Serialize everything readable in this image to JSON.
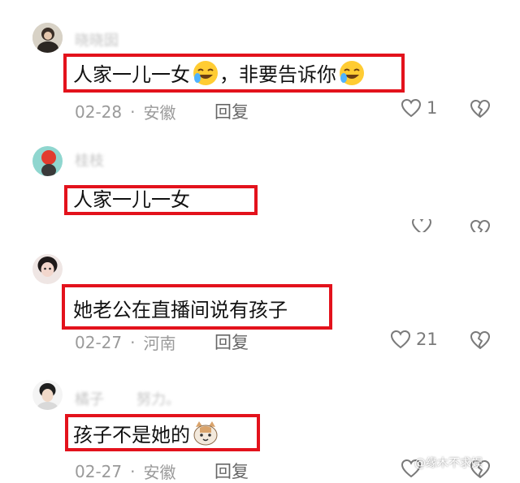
{
  "comments": [
    {
      "username": "晓晓囡",
      "text": "人家一儿一女",
      "text_suffix": "，非要告诉你",
      "date": "02-28",
      "location": "安徽",
      "reply_label": "回复",
      "likes": "1",
      "emojis": [
        "rofl-emoji",
        "rofl-emoji"
      ]
    },
    {
      "username": "桂枝",
      "text": "人家一儿一女",
      "likes": ""
    },
    {
      "username": "",
      "text": "她老公在直播间说有孩子",
      "date": "02-27",
      "location": "河南",
      "reply_label": "回复",
      "likes": "21"
    },
    {
      "username": "橘子",
      "username_suffix": "努力。",
      "text": "孩子不是她的",
      "date": "02-27",
      "location": "安徽",
      "reply_label": "回复",
      "likes": "",
      "emojis": [
        "cat-emoji"
      ]
    }
  ],
  "watermark": "@缘木不求娱",
  "colors": {
    "highlight": "#e3121c",
    "meta": "#9a9a9a",
    "icon": "#7a7a7a"
  }
}
